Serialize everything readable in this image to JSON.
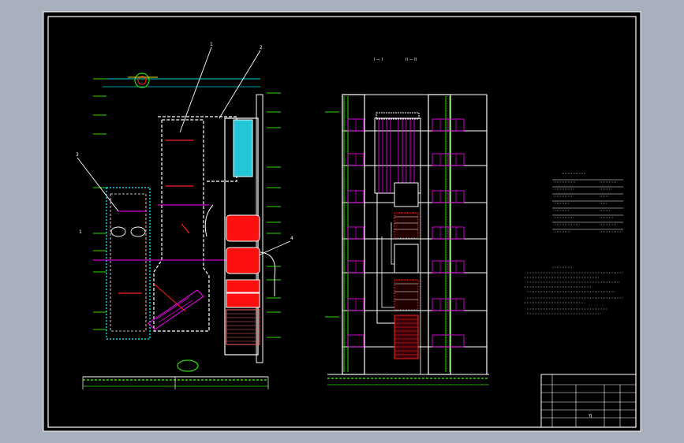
{
  "drawing": {
    "left_view_label": "1",
    "callouts": [
      "1",
      "2",
      "3",
      "4"
    ],
    "section_label_a": "I — I",
    "section_label_b": "II — II",
    "title_block_code": "YJ"
  },
  "palette": {
    "background": "#000000",
    "window_bg": "#a9b0bd",
    "line_white": "#ffffff",
    "line_cyan": "#00d8e0",
    "line_green": "#31d800",
    "line_magenta": "#ff00ff",
    "line_red": "#ff2020",
    "line_yellow": "#ffe000",
    "fill_red": "#ff1010",
    "fill_cyan": "#22c6d8"
  }
}
